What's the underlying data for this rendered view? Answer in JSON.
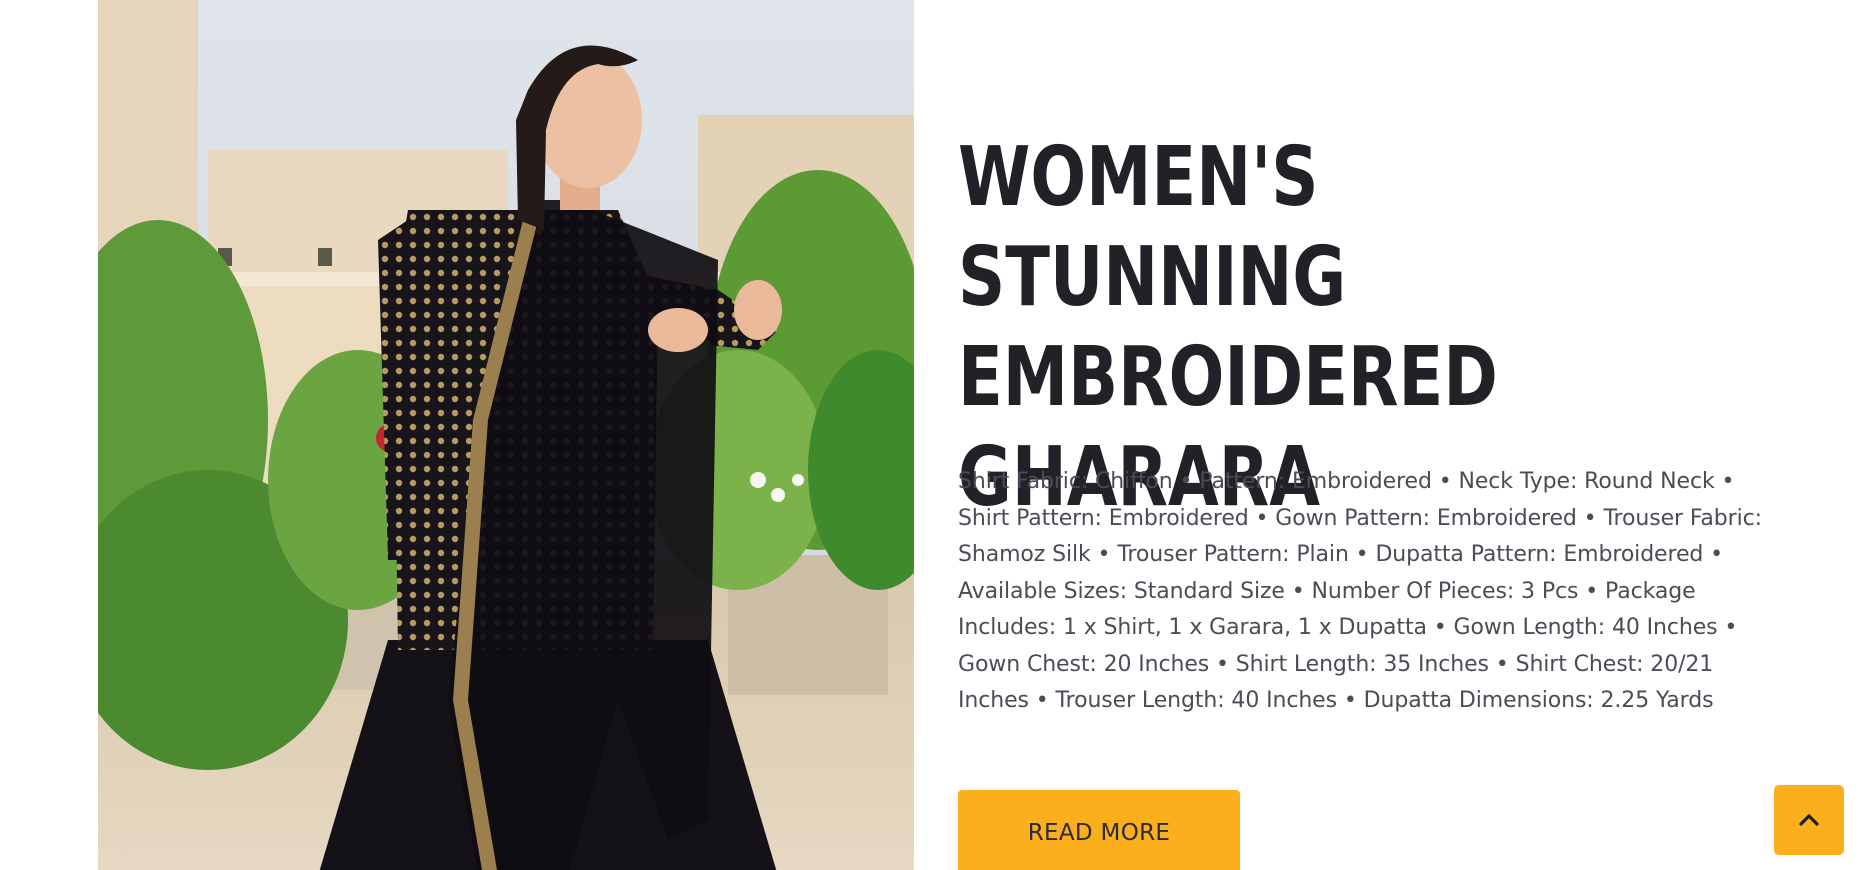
{
  "product": {
    "title": "WOMEN'S STUNNING EMBROIDERED GHARARA",
    "description": "Shirt Fabric: Chiffon • Pattern: Embroidered • Neck Type: Round Neck • Shirt Pattern: Embroidered • Gown Pattern: Embroidered • Trouser Fabric: Shamoz Silk • Trouser Pattern: Plain • Dupatta Pattern: Embroidered • Available Sizes: Standard Size • Number Of Pieces: 3 Pcs • Package Includes: 1 x Shirt, 1 x Garara, 1 x Dupatta • Gown Length: 40 Inches • Gown Chest: 20 Inches • Shirt Length: 35 Inches • Shirt Chest: 20/21 Inches • Trouser Length: 40 Inches • Dupatta Dimensions: 2.25 Yards",
    "read_more_label": "READ MORE"
  },
  "icons": {
    "back_to_top": "chevron-up-icon"
  },
  "colors": {
    "accent": "#fcaf1c",
    "title": "#212228",
    "body_text": "#4b4c56",
    "background": "#ffffff"
  }
}
